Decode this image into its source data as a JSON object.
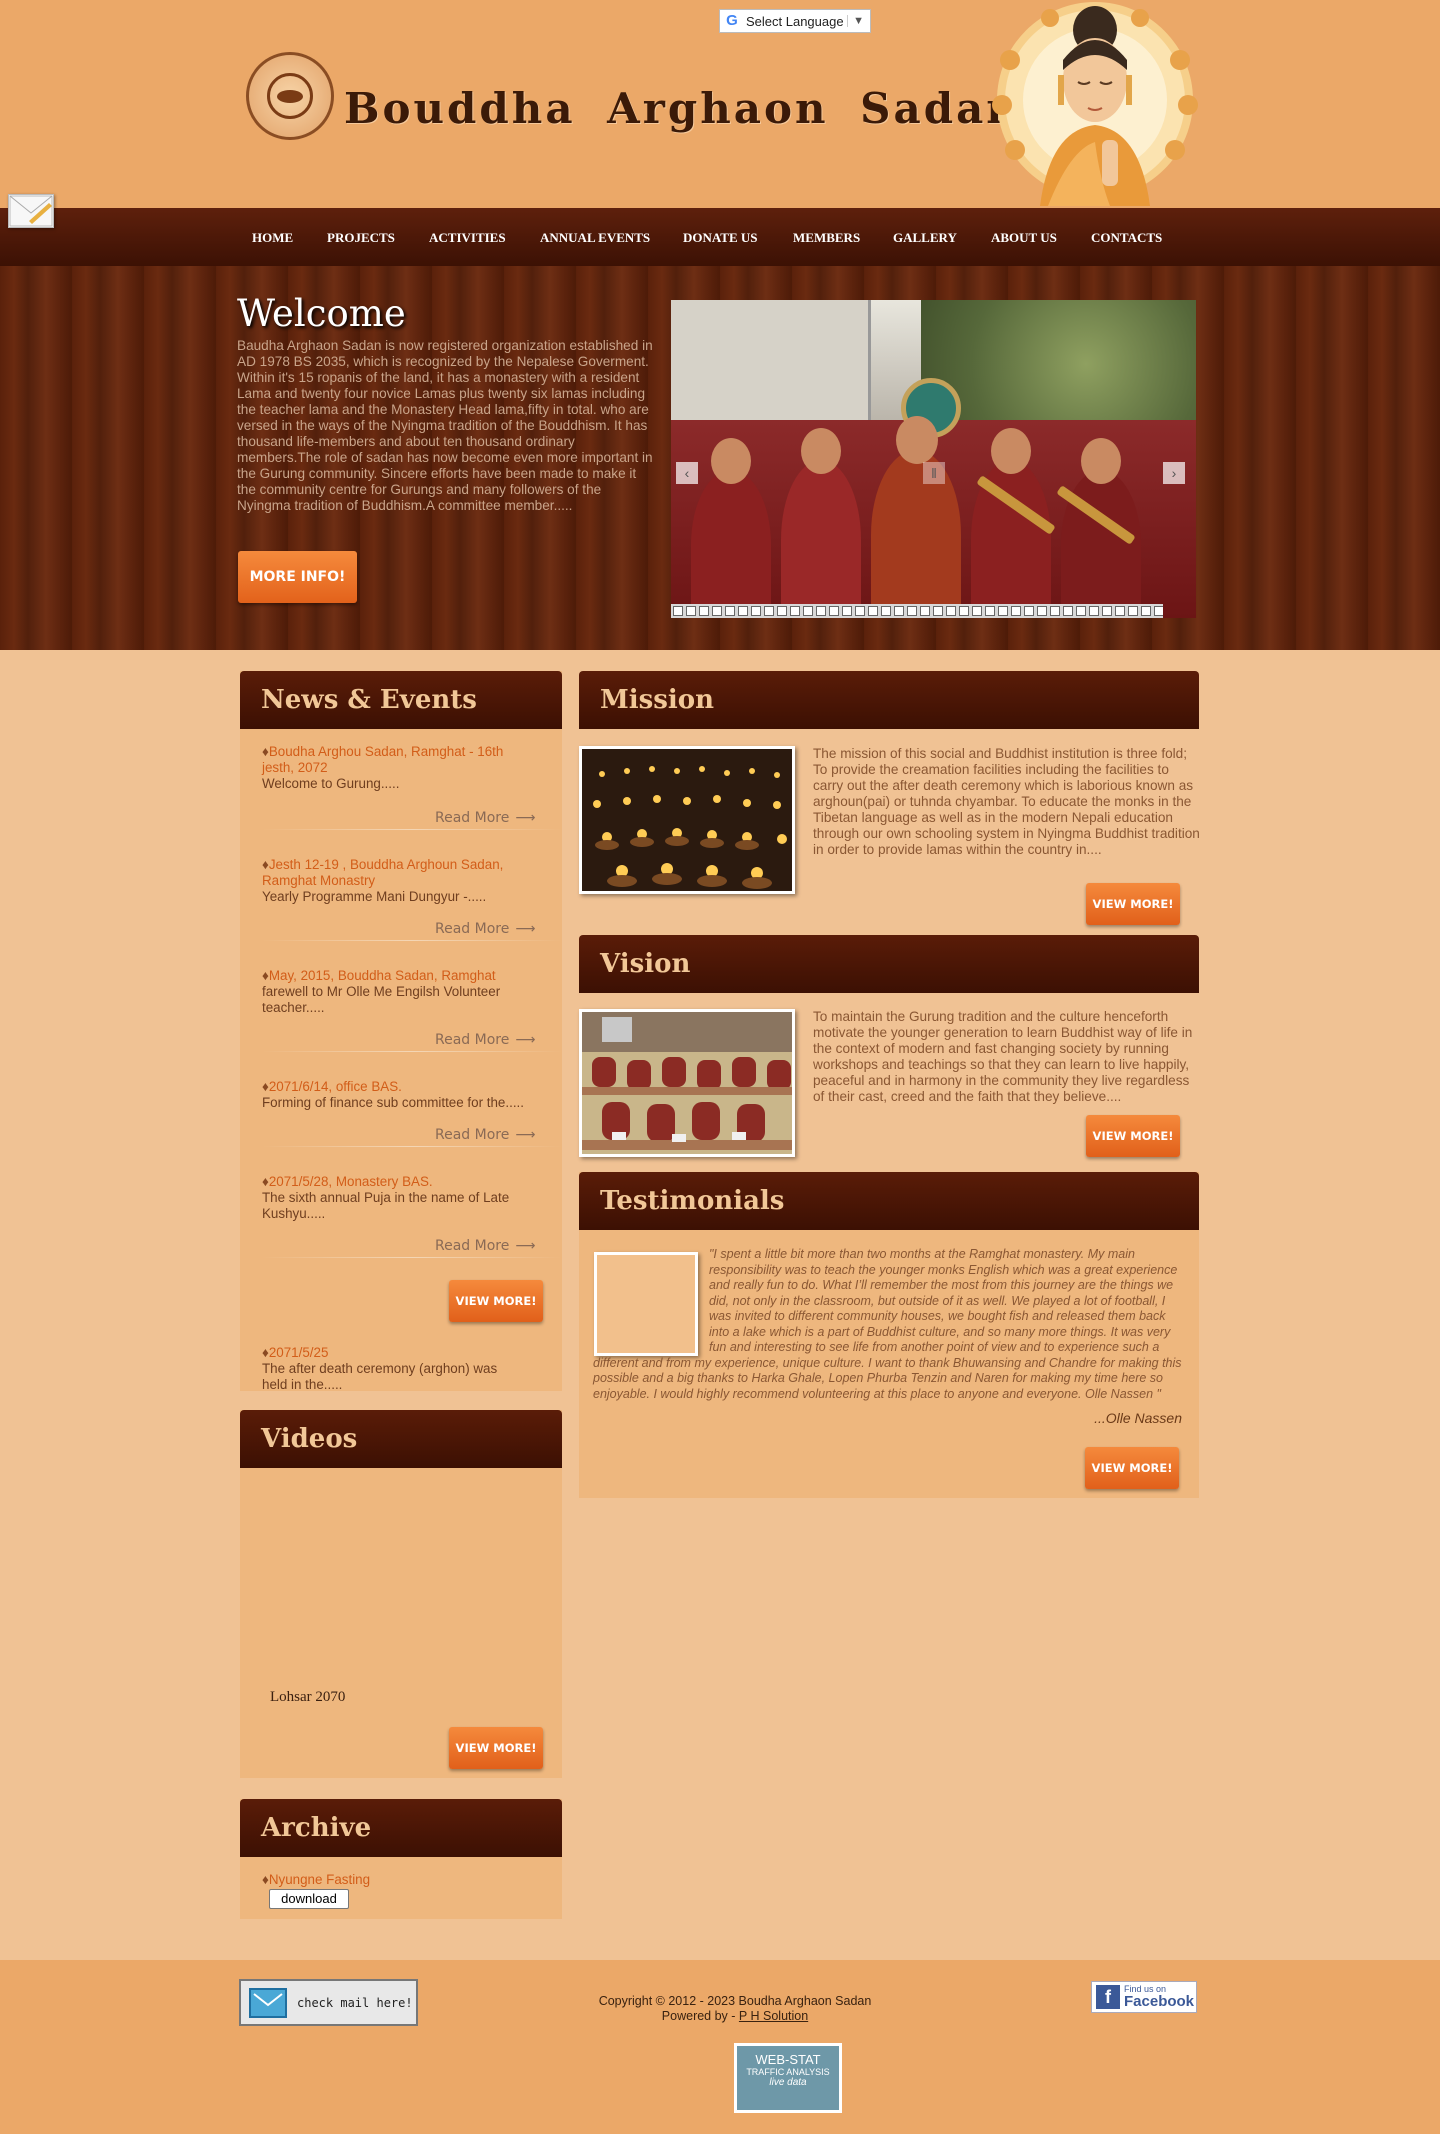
{
  "header": {
    "language_select": "Select Language",
    "site_title": "Bouddha Arghaon Sadan"
  },
  "nav": {
    "items": [
      "HOME",
      "PROJECTS",
      "ACTIVITIES",
      "ANNUAL EVENTS",
      "DONATE US",
      "MEMBERS",
      "GALLERY",
      "ABOUT US",
      "CONTACTS"
    ]
  },
  "hero": {
    "title": "Welcome",
    "text": "Baudha Arghaon Sadan is now registered organization established in AD 1978 BS 2035, which is recognized by the Nepalese Goverment. Within it's 15 ropanis of the land, it has a monastery with a resident Lama and twenty four novice Lamas plus twenty six lamas including the teacher lama and the Monastery Head lama,fifty in total. who are versed in the ways of the Nyingma tradition of the Bouddhism. It has thousand life-members and about ten thousand ordinary members.The role of sadan has now become even more important in the Gurung community. Sincere efforts have been made to make it the community centre for Gurungs and many followers of the Nyingma tradition of Buddhism.A committee member.....",
    "more_info": "MORE INFO!",
    "slider_prev": "‹",
    "slider_next": "›"
  },
  "news": {
    "title": "News & Events",
    "read_more": "Read More",
    "view_more": "VIEW MORE!",
    "items": [
      {
        "title": "Boudha Arghou Sadan, Ramghat - 16th jesth, 2072",
        "desc": "Welcome to Gurung....."
      },
      {
        "title": "Jesth 12-19 , Bouddha Arghoun Sadan, Ramghat Monastry",
        "desc": "Yearly Programme Mani Dungyur -....."
      },
      {
        "title": "May, 2015, Bouddha Sadan, Ramghat",
        "desc": "farewell to Mr Olle Me Engilsh Volunteer teacher....."
      },
      {
        "title": "2071/6/14, office BAS.",
        "desc": "Forming of finance sub committee for the....."
      },
      {
        "title": "2071/5/28, Monastery BAS.",
        "desc": "The sixth annual Puja in the name of Late Kushyu....."
      },
      {
        "title": "2071/5/25",
        "desc": "The after death ceremony (arghon) was held in the....."
      }
    ]
  },
  "videos": {
    "title": "Videos",
    "caption": "Lohsar 2070",
    "view_more": "VIEW MORE!"
  },
  "archive": {
    "title": "Archive",
    "item": "Nyungne Fasting",
    "download": "download"
  },
  "mission": {
    "title": "Mission",
    "text": "The mission of this social and Buddhist institution is three fold; To provide the creamation facilities including the facilities to carry out the after death ceremony which is laborious known as arghoun(pai) or tuhnda chyambar. To educate the monks in the Tibetan language as well as in the modern Nepali education through our own schooling system in Nyingma Buddhist tradition in order to provide lamas within the country in....",
    "view_more": "VIEW MORE!"
  },
  "vision": {
    "title": "Vision",
    "text": "To maintain the Gurung tradition and the culture henceforth motivate the younger generation to learn Buddhist way of life in the context of modern and fast changing society by running workshops and teachings so that they can learn to live happily, peaceful and in harmony in the community they live regardless of their cast, creed and the faith that they believe....",
    "view_more": "VIEW MORE!"
  },
  "testimonials": {
    "title": "Testimonials",
    "quote": "\"I spent a little bit more than two months at the Ramghat monastery. My main responsibility was to teach the younger monks English which was a great experience and really fun to do. What I’ll remember the most from this journey are the things we did, not only in the classroom, but outside of it as well. We played a lot of football, I was invited to different community houses, we bought fish and released them back into a lake which is a part of Buddhist culture, and so many more things. It was very fun and interesting to see life from another point of view and to experience such a different and from my experience, unique culture. I want to thank Bhuwansing and Chandre for making this possible and a big thanks to Harka Ghale, Lopen Phurba Tenzin and Naren for making my time here so enjoyable. I would highly recommend volunteering at this place to anyone and everyone. Olle Nassen \"",
    "author": "...Olle Nassen",
    "view_more": "VIEW MORE!"
  },
  "footer": {
    "check_mail": "check mail here!",
    "copyright": "Copyright © 2012 - 2023 Boudha Arghaon Sadan",
    "powered_by": "Powered by - ",
    "powered_link": "P H Solution",
    "facebook_small": "Find us on",
    "facebook_big": "Facebook",
    "webstat_title": "WEB-STAT",
    "webstat_sub": "TRAFFIC ANALYSIS",
    "webstat_live": "live data"
  },
  "colors": {
    "header_bg": "#eba868",
    "nav_bg": "#4a1606",
    "page_bg": "#f0c294",
    "accent_orange": "#e96f24",
    "link_orange": "#d25d19"
  }
}
